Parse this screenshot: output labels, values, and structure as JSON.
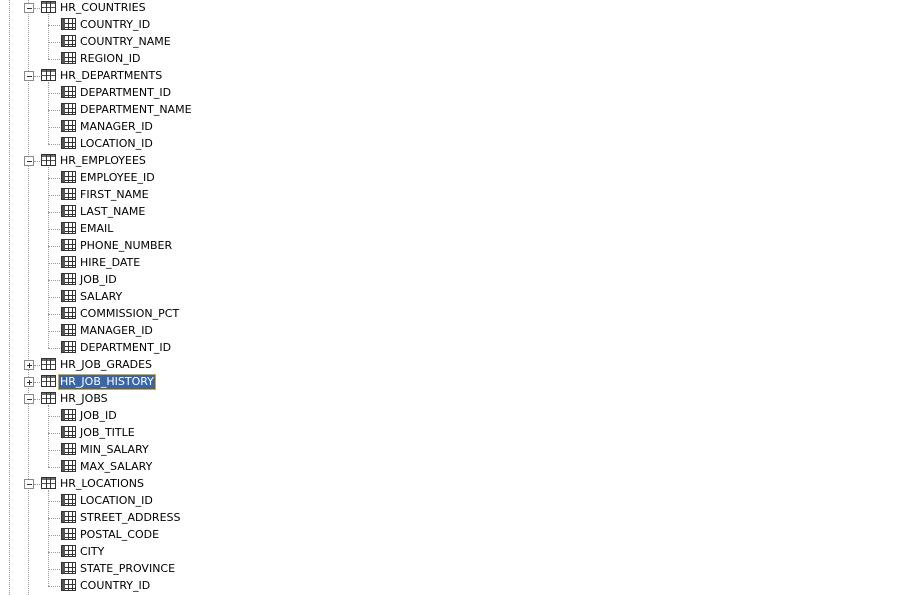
{
  "tree": {
    "tables": [
      {
        "name": "HR_COUNTRIES",
        "expanded": true,
        "selected": false,
        "columns": [
          "COUNTRY_ID",
          "COUNTRY_NAME",
          "REGION_ID"
        ]
      },
      {
        "name": "HR_DEPARTMENTS",
        "expanded": true,
        "selected": false,
        "columns": [
          "DEPARTMENT_ID",
          "DEPARTMENT_NAME",
          "MANAGER_ID",
          "LOCATION_ID"
        ]
      },
      {
        "name": "HR_EMPLOYEES",
        "expanded": true,
        "selected": false,
        "columns": [
          "EMPLOYEE_ID",
          "FIRST_NAME",
          "LAST_NAME",
          "EMAIL",
          "PHONE_NUMBER",
          "HIRE_DATE",
          "JOB_ID",
          "SALARY",
          "COMMISSION_PCT",
          "MANAGER_ID",
          "DEPARTMENT_ID"
        ]
      },
      {
        "name": "HR_JOB_GRADES",
        "expanded": false,
        "selected": false,
        "columns": []
      },
      {
        "name": "HR_JOB_HISTORY",
        "expanded": false,
        "selected": true,
        "columns": []
      },
      {
        "name": "HR_JOBS",
        "expanded": true,
        "selected": false,
        "columns": [
          "JOB_ID",
          "JOB_TITLE",
          "MIN_SALARY",
          "MAX_SALARY"
        ]
      },
      {
        "name": "HR_LOCATIONS",
        "expanded": true,
        "selected": false,
        "columns": [
          "LOCATION_ID",
          "STREET_ADDRESS",
          "POSTAL_CODE",
          "CITY",
          "STATE_PROVINCE",
          "COUNTRY_ID"
        ]
      }
    ]
  }
}
